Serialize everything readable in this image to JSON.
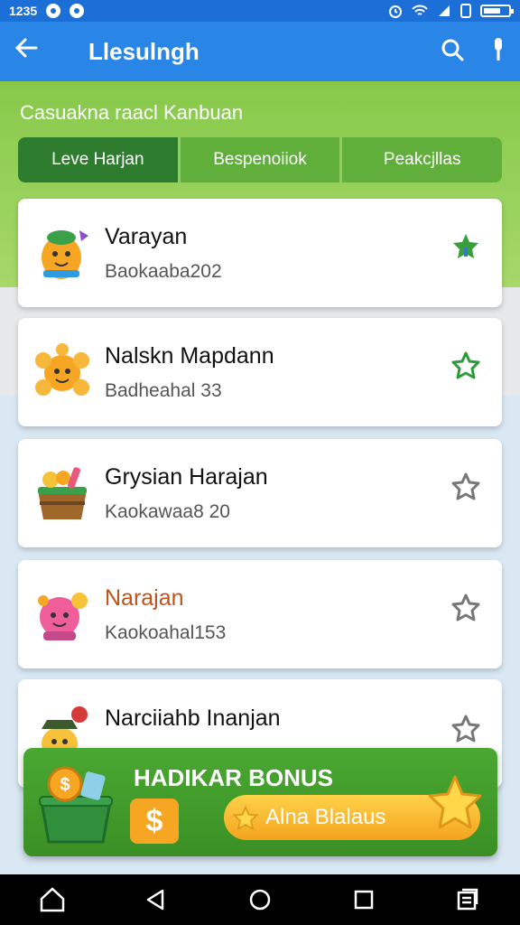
{
  "status_bar": {
    "time": "1235"
  },
  "app_bar": {
    "title": "Llesulngh"
  },
  "subtitle": "Casuakna raacl Kanbuan",
  "tabs": [
    {
      "label": "Leve Harjan",
      "active": true
    },
    {
      "label": "Bespenoiiok",
      "active": false
    },
    {
      "label": "Peakcjllas",
      "active": false
    }
  ],
  "list": [
    {
      "name": "Varayan",
      "sub": "Baokaaba202",
      "name_color": "#111111",
      "star": "green-outline"
    },
    {
      "name": "Nalskn Mapdann",
      "sub": "Badheahal 33",
      "name_color": "#111111",
      "star": "green-outline"
    },
    {
      "name": "Grysian Harajan",
      "sub": "Kaokawaa8 20",
      "name_color": "#111111",
      "star": "grey-outline"
    },
    {
      "name": "Narajan",
      "sub": "Kaokoahal153",
      "name_color": "#c0531a",
      "star": "grey-outline"
    },
    {
      "name": "Narciiahb Inanjan",
      "sub": "",
      "name_color": "#111111",
      "star": "grey-outline"
    }
  ],
  "bonus": {
    "title": "HADIKAR BONUS",
    "dollar_symbol": "$",
    "claim_label": "Alna Blalaus"
  },
  "colors": {
    "accent": "#2a86e6",
    "green": "#4aa832",
    "tab_active": "#2e7d2e"
  },
  "icons": [
    "back-arrow-icon",
    "search-icon",
    "microphone-icon",
    "star-icon",
    "home-icon",
    "back-triangle-icon",
    "circle-home-icon",
    "square-recents-icon",
    "menu-icon"
  ]
}
